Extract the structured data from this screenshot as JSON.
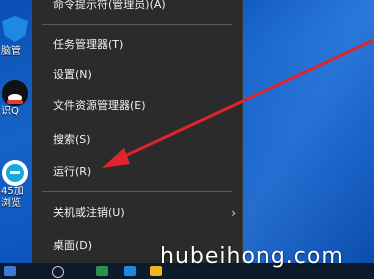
{
  "desktop_icons": [
    {
      "name": "icon-security",
      "caption": "",
      "color": "#1e88e5"
    },
    {
      "name": "icon-brain",
      "caption": "脑管",
      "color": "#2b7bd8"
    },
    {
      "name": "icon-qq",
      "caption": "识Q",
      "color": "#111111"
    },
    {
      "name": "icon-browser",
      "caption": "45加",
      "color": "#19a7e0"
    },
    {
      "name": "icon-browser-sub",
      "caption": "浏览",
      "color": "#19a7e0"
    }
  ],
  "menu": {
    "items": [
      {
        "label": "命令提示符(管理员)(A)"
      },
      {
        "label": "任务管理器(T)"
      },
      {
        "label": "设置(N)"
      },
      {
        "label": "文件资源管理器(E)"
      },
      {
        "label": "搜索(S)"
      },
      {
        "label": "运行(R)"
      },
      {
        "label": "关机或注销(U)",
        "submenu": true
      },
      {
        "label": "桌面(D)"
      }
    ],
    "submenu_chevron": "›"
  },
  "watermark": "hubeihong.com",
  "colors": {
    "menu_bg": "#2b2b2b",
    "arrow": "#e0242c",
    "desktop": "#1663c8"
  }
}
